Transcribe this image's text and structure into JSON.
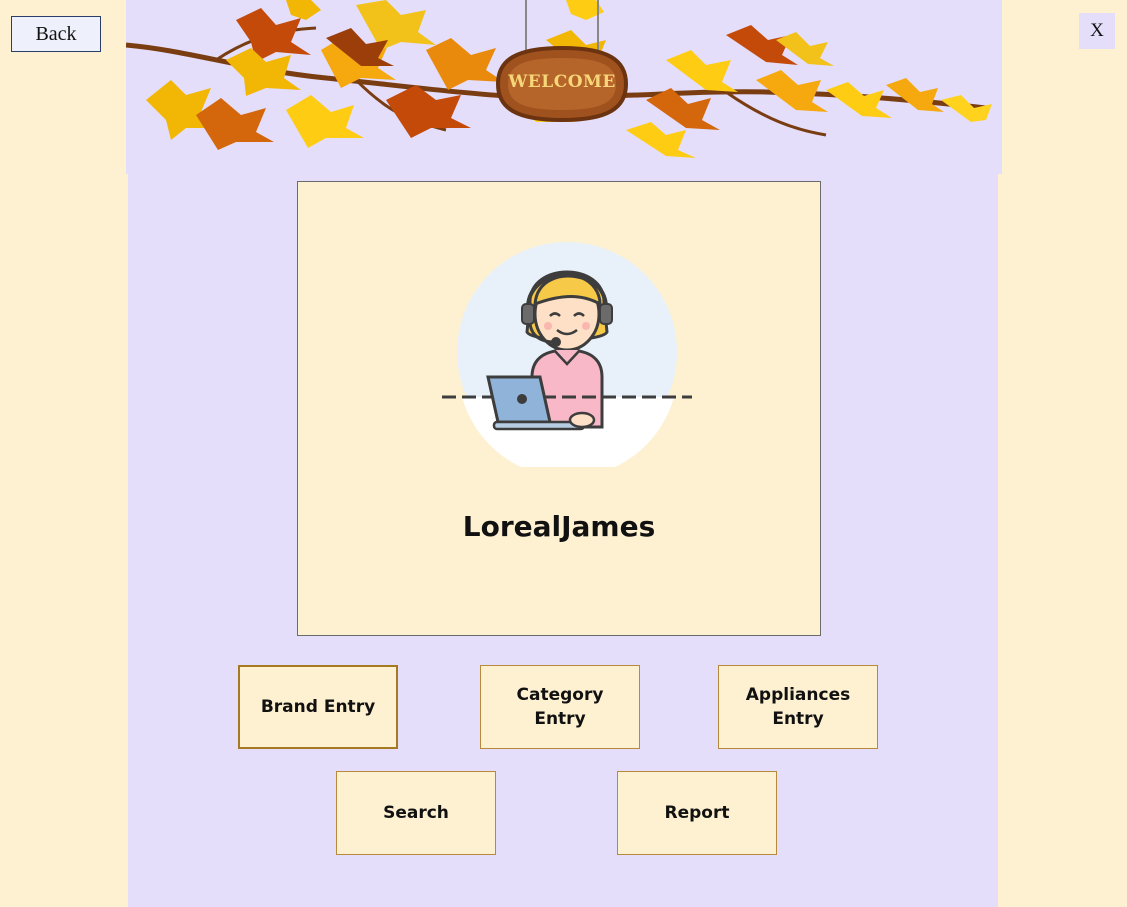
{
  "window": {
    "back_label": "Back",
    "close_label": "X"
  },
  "banner": {
    "sign_text": "WELCOME"
  },
  "profile": {
    "user_name": "LorealJames"
  },
  "actions": {
    "brand_entry": "Brand Entry",
    "category_entry": "Category Entry",
    "appliances_entry": "Appliances Entry",
    "search": "Search",
    "report": "Report"
  },
  "colors": {
    "page_background": "#fdf1d2",
    "panel_background": "#e4defa",
    "button_border": "#b8893a"
  }
}
